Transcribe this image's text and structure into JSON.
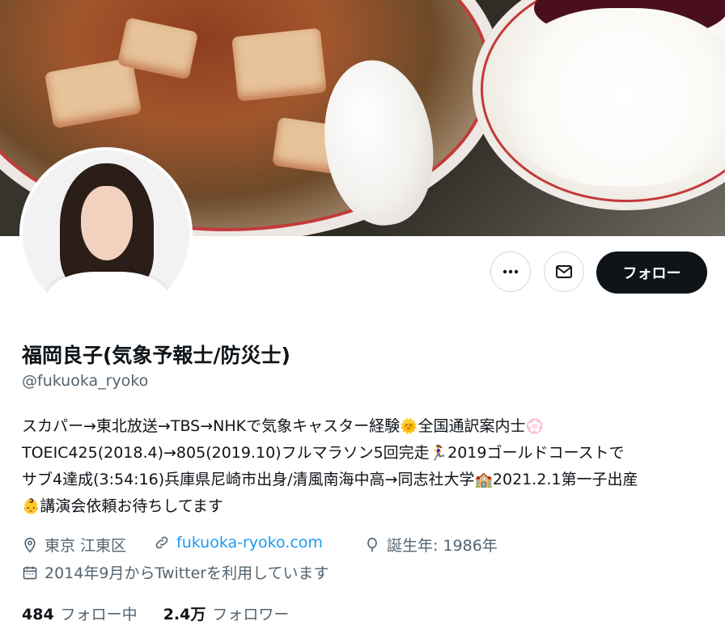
{
  "profile": {
    "name": "福岡良子(気象予報士/防災士)",
    "handle": "@fukuoka_ryoko",
    "bio_lines": [
      "スカパー→東北放送→TBS→NHKで気象キャスター経験",
      "全国通訳案内士",
      "TOEIC425(2018.4)→805(2019.10)フルマラソン5回完走",
      "2019ゴールドコーストで",
      "サブ4達成(3:54:16)兵庫県尼崎市出身/清風南海中高→同志社大学",
      "2021.2.1第一子出産",
      "講演会依頼お待ちしてます"
    ],
    "location": "東京 江東区",
    "website": "fukuoka-ryoko.com",
    "birth": "誕生年: 1986年",
    "joined": "2014年9月からTwitterを利用しています"
  },
  "actions": {
    "more_icon": "more-horizontal-icon",
    "message_icon": "envelope-icon",
    "follow_label": "フォロー"
  },
  "stats": {
    "following_count": "484",
    "following_label": "フォロー中",
    "followers_count": "2.4万",
    "followers_label": "フォロワー"
  },
  "colors": {
    "accent": "#1d9bf0",
    "text_primary": "#0f1419",
    "text_secondary": "#536471",
    "button_dark": "#0f1419"
  }
}
